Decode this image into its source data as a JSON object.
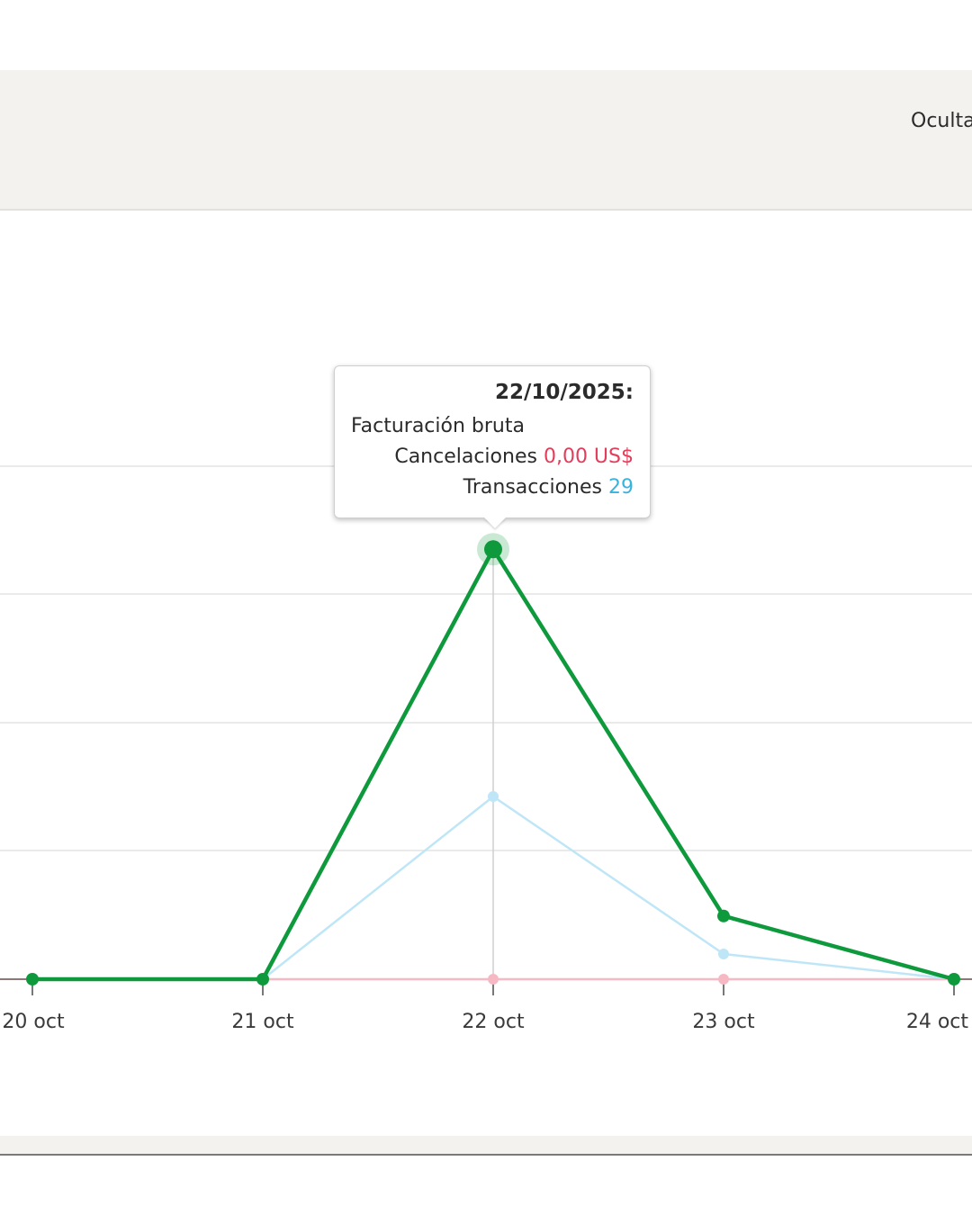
{
  "toolbar": {
    "hide_label": "Oculta"
  },
  "chart_data": {
    "type": "line",
    "categories": [
      "20 oct",
      "21 oct",
      "22 oct",
      "23 oct",
      "24 oct"
    ],
    "series": [
      {
        "name": "Facturación bruta",
        "color": "#0e9a3c",
        "values": [
          0,
          0,
          17,
          2.5,
          0
        ]
      },
      {
        "name": "Transacciones",
        "color": "#bfe6f7",
        "values": [
          0,
          0,
          29,
          4,
          0
        ]
      },
      {
        "name": "Cancelaciones",
        "color": "#f6b9c4",
        "values": [
          0,
          0,
          0,
          0,
          0
        ]
      }
    ],
    "colors": {
      "red": "#e33d5b",
      "blue": "#36b4e0",
      "green": "#0e9a3c"
    },
    "grid": true
  },
  "tooltip": {
    "date": "22/10/2025:",
    "row1_label": "Facturación bruta",
    "row2_label": "Cancelaciones",
    "row2_value": "0,00 US$",
    "row3_label": "Transacciones",
    "row3_value": "29"
  }
}
